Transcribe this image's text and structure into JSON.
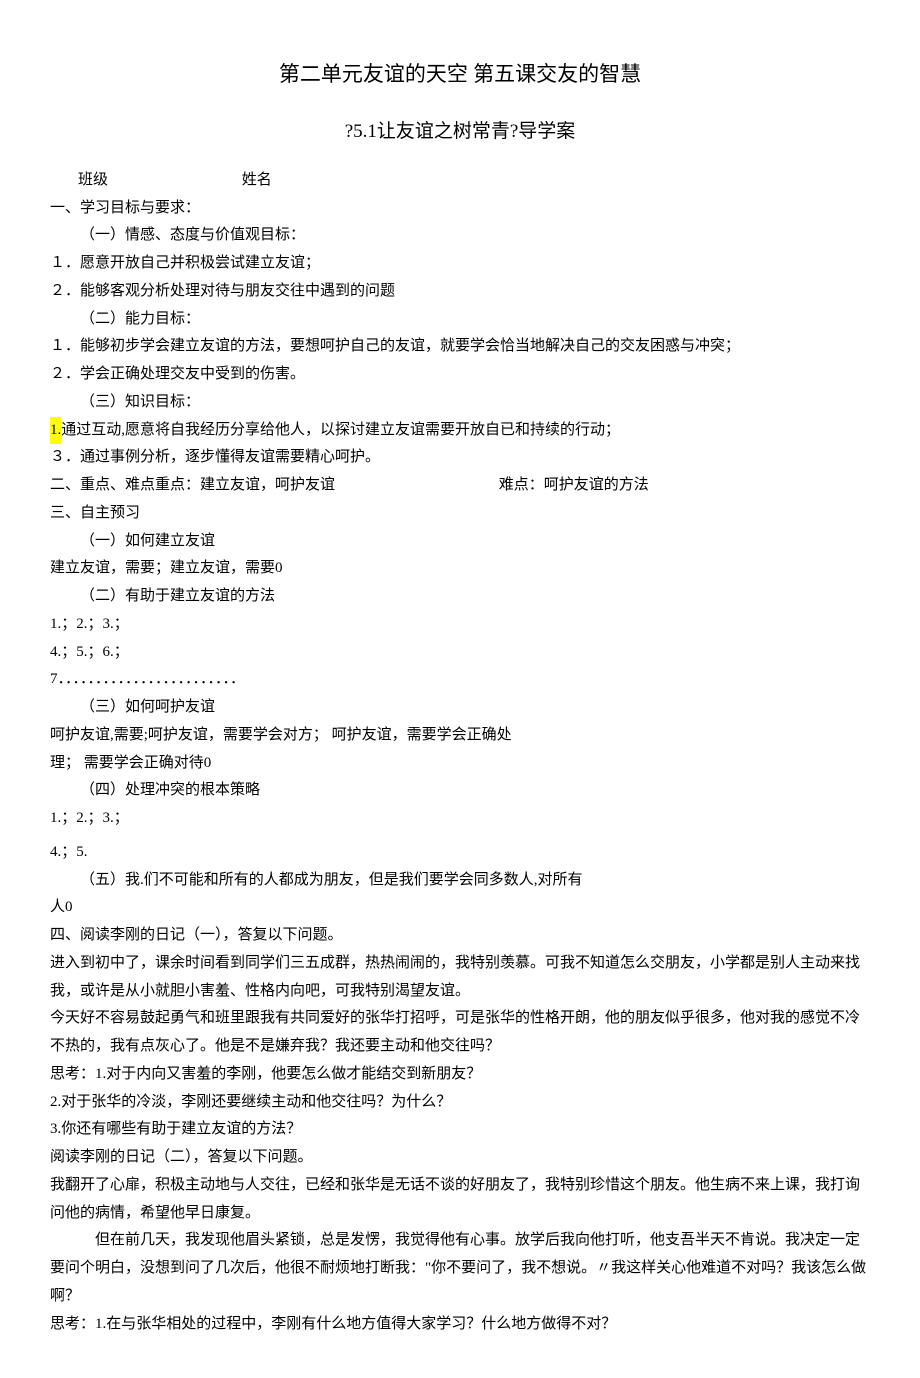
{
  "header": {
    "unit_title": "第二单元友谊的天空      第五课交友的智慧",
    "lesson_title": "?5.1让友谊之树常青?导学案",
    "class_label": "班级",
    "name_label": "姓名"
  },
  "section1": {
    "heading": "一、学习目标与要求：",
    "sub1": "（一）情感、态度与价值观目标：",
    "item1": "１．愿意开放自己并积极尝试建立友谊；",
    "item2": "２．能够客观分析处理对待与朋友交往中遇到的问题",
    "sub2": "（二）能力目标：",
    "item3": "１．能够初步学会建立友谊的方法，要想呵护自己的友谊，就要学会恰当地解决自己的交友困惑与冲突；",
    "item4": "２．学会正确处理交友中受到的伤害。",
    "sub3": "（三）知识目标：",
    "item5_hl": "1.",
    "item5_rest": "通过互动,愿意将自我经历分享给他人，以探讨建立友谊需要开放自已和持续的行动；",
    "item6": "３．通过事例分析，逐步懂得友谊需要精心呵护。"
  },
  "section2": {
    "left": "二、重点、难点重点：建立友谊，呵护友谊",
    "right": "难点：呵护友谊的方法"
  },
  "section3": {
    "heading": "三、自主预习",
    "sub1": "（一）如何建立友谊",
    "line1": "建立友谊，需要；建立友谊，需要0",
    "sub2": "（二）有助于建立友谊的方法",
    "line2": "1.；2.；3.；",
    "line3": "4.；5.；6.；",
    "line4": "7．．．．．．．．．．．．．．．．．．．．．．．．",
    "sub3": "（三）如何呵护友谊",
    "line5": "呵护友谊,需要;呵护友谊，需要学会对方； 呵护友谊，需要学会正确处",
    "line6": "理； 需要学会正确对待0",
    "sub4": "（四）处理冲突的根本策略",
    "line7": "1.；2.；3.；",
    "line8": "4.；5.",
    "sub5": "（五）我.们不可能和所有的人都成为朋友，但是我们要学会同多数人,对所有",
    "line9": "人0"
  },
  "section4": {
    "heading": "四、阅读李刚的日记（一），答复以下问题。",
    "p1": "进入到初中了，课余时间看到同学们三五成群，热热闹闹的，我特别羡慕。可我不知道怎么交朋友，小学都是别人主动来找我，或许是从小就胆小害羞、性格内向吧，可我特别渴望友谊。",
    "p2": "今天好不容易鼓起勇气和班里跟我有共同爱好的张华打招呼，可是张华的性格开朗，他的朋友似乎很多，他对我的感觉不冷不热的，我有点灰心了。他是不是嫌弃我？我还要主动和他交往吗？",
    "q1": "思考：1.对于内向又害羞的李刚，他要怎么做才能结交到新朋友？",
    "q2": "2.对于张华的冷淡，李刚还要继续主动和他交往吗？为什么？",
    "q3": "3.你还有哪些有助于建立友谊的方法？"
  },
  "section5": {
    "heading": "阅读李刚的日记（二），答复以下问题。",
    "p1": "我翻开了心扉，积极主动地与人交往，已经和张华是无话不谈的好朋友了，我特别珍惜这个朋友。他生病不来上课，我打询问他的病情，希望他早日康复。",
    "p2": "但在前几天，我发现他眉头紧锁，总是发愣，我觉得他有心事。放学后我向他打听，他支吾半天不肯说。我决定一定要问个明白，没想到问了几次后，他很不耐烦地打断我：\"你不要问了，我不想说。〃我这样关心他难道不对吗？我该怎么做啊？",
    "q1": "思考：1.在与张华相处的过程中，李刚有什么地方值得大家学习？什么地方做得不对？"
  }
}
